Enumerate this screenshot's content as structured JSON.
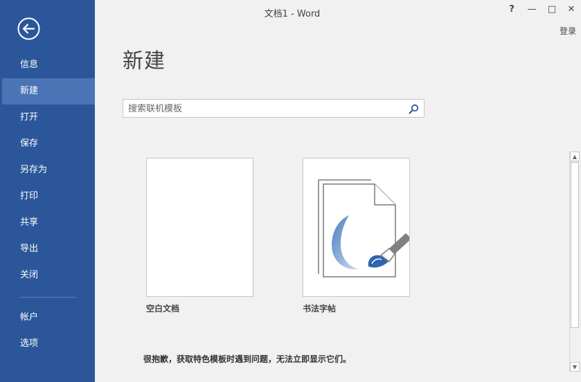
{
  "window": {
    "title": "文档1 - Word",
    "help_label": "?",
    "minimize_label": "—",
    "maximize_label": "□",
    "close_label": "✕",
    "login_label": "登录"
  },
  "sidebar": {
    "items": [
      {
        "label": "信息"
      },
      {
        "label": "新建",
        "active": true
      },
      {
        "label": "打开"
      },
      {
        "label": "保存"
      },
      {
        "label": "另存为"
      },
      {
        "label": "打印"
      },
      {
        "label": "共享"
      },
      {
        "label": "导出"
      },
      {
        "label": "关闭"
      }
    ],
    "bottom_items": [
      {
        "label": "帐户"
      },
      {
        "label": "选项"
      }
    ]
  },
  "main": {
    "title": "新建",
    "search": {
      "value": "",
      "placeholder": "搜索联机模板"
    },
    "templates": [
      {
        "label": "空白文档"
      },
      {
        "label": "书法字帖"
      }
    ],
    "notice": "很抱歉，获取特色模板时遇到问题，无法立即显示它们。"
  },
  "colors": {
    "sidebar": "#2b579a",
    "sidebar_active": "#4a74b6",
    "calligraphy_blue": "#3b6fb6"
  },
  "icons": {
    "back": "back-arrow-icon",
    "search": "search-icon",
    "calligraphy": "brush-document-icon"
  }
}
